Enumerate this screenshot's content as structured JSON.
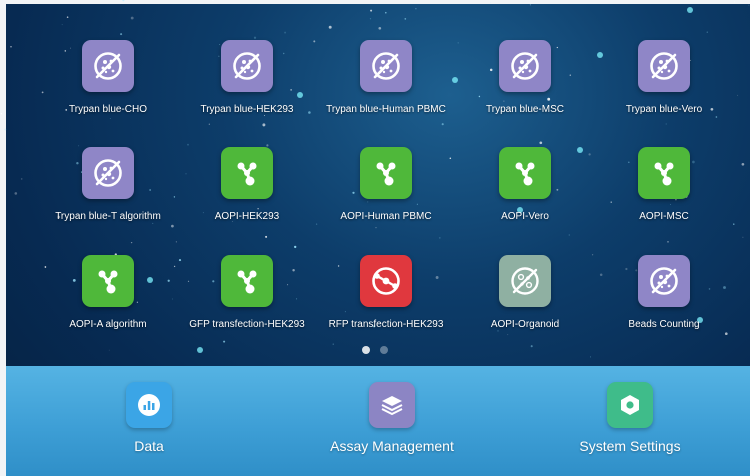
{
  "apps": [
    {
      "label": "Trypan blue-CHO",
      "icon": "trypan-blue-icon",
      "color": "#8f86c7"
    },
    {
      "label": "Trypan blue-HEK293",
      "icon": "trypan-blue-icon",
      "color": "#8f86c7"
    },
    {
      "label": "Trypan blue-Human PBMC",
      "icon": "trypan-blue-icon",
      "color": "#8f86c7"
    },
    {
      "label": "Trypan blue-MSC",
      "icon": "trypan-blue-icon",
      "color": "#8f86c7"
    },
    {
      "label": "Trypan blue-Vero",
      "icon": "trypan-blue-icon",
      "color": "#8f86c7"
    },
    {
      "label": "Trypan blue-T algorithm",
      "icon": "trypan-blue-icon",
      "color": "#8f86c7"
    },
    {
      "label": "AOPI-HEK293",
      "icon": "aopi-molecule-icon",
      "color": "#4fb83a"
    },
    {
      "label": "AOPI-Human PBMC",
      "icon": "aopi-molecule-icon",
      "color": "#4fb83a"
    },
    {
      "label": "AOPI-Vero",
      "icon": "aopi-molecule-icon",
      "color": "#4fb83a"
    },
    {
      "label": "AOPI-MSC",
      "icon": "aopi-molecule-icon",
      "color": "#4fb83a"
    },
    {
      "label": "AOPI-A algorithm",
      "icon": "aopi-molecule-icon",
      "color": "#4fb83a"
    },
    {
      "label": "GFP transfection-HEK293",
      "icon": "aopi-molecule-icon",
      "color": "#4fb83a"
    },
    {
      "label": "RFP transfection-HEK293",
      "icon": "rfp-ring-icon",
      "color": "#e0383e"
    },
    {
      "label": "AOPI-Organoid",
      "icon": "organoid-icon",
      "color": "#8fb0a2"
    },
    {
      "label": "Beads Counting",
      "icon": "trypan-blue-icon",
      "color": "#8f86c7"
    }
  ],
  "pager": {
    "pages": 2,
    "active": 0
  },
  "dock": [
    {
      "label": "Data",
      "icon": "chart-icon",
      "color": "#3ba5e6"
    },
    {
      "label": "Assay Management",
      "icon": "layers-icon",
      "color": "#8c85c4"
    },
    {
      "label": "System Settings",
      "icon": "hexagon-settings-icon",
      "color": "#3fbc8a"
    }
  ]
}
